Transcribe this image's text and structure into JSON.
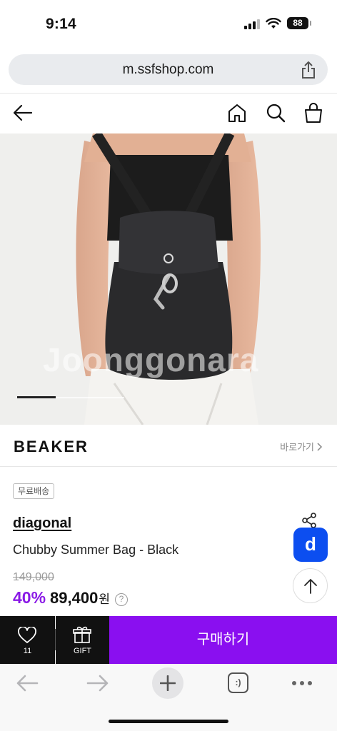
{
  "status_bar": {
    "time": "9:14",
    "battery": "88"
  },
  "browser": {
    "url": "m.ssfshop.com"
  },
  "product_image": {
    "watermark": "Joonggonara",
    "slide_progress": 0.36
  },
  "brand": {
    "logo": "BEAKER",
    "link_label": "바로가기"
  },
  "product": {
    "badge": "무료배송",
    "brand_name": "diagonal",
    "name": "Chubby Summer Bag - Black",
    "original_price": "149,000",
    "discount": "40%",
    "sale_price": "89,400",
    "currency": "원",
    "help_mark": "?"
  },
  "floating": {
    "d_label": "d"
  },
  "purchase_bar": {
    "wish_count": "11",
    "gift_label": "GIFT",
    "buy_label": "구매하기"
  },
  "toolbar": {
    "tabs_label": ":)"
  },
  "colors": {
    "accent": "#8a0ff0",
    "discount": "#8a1ae6",
    "floating_button": "#0c4ef0"
  }
}
